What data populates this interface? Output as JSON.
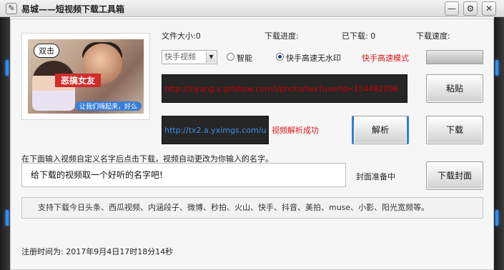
{
  "window": {
    "title": "易城——短视频下载工具箱",
    "icon": "app-icon",
    "controls": [
      "minimize-icon",
      "settings-icon",
      "close-icon"
    ]
  },
  "thumbnail": {
    "bubble_text": "双击",
    "red_caption": "恶搞女友",
    "blue_caption": "让我们嗨起来，好么"
  },
  "status": {
    "file_size_label": "文件大小:0",
    "progress_label": "下载进度:",
    "downloaded_label": "已下载: 0",
    "speed_label": "下载速度:"
  },
  "mode": {
    "select_value": "快手视频",
    "radio_smart": "智能",
    "radio_fast": "快手高速无水印",
    "selected": "fast",
    "mode_text": "快手高速模式"
  },
  "urls": {
    "source_url": "http://ziyang.s.gifshow.com/i/photo/lwx?userId=154462096",
    "parsed_url": "http://tx2.a.yximgs.com/u",
    "parse_status": "视频解析成功"
  },
  "buttons": {
    "paste": "粘贴",
    "parse": "解析",
    "download": "下载",
    "download_cover": "下载封面"
  },
  "naming": {
    "hint": "在下面输入视频自定义名字后点击下载，视频自动更改为你输入的名字。",
    "input_value": "给下载的视频取一个好听的名字吧!",
    "cover_status": "封面准备中"
  },
  "platforms_text": "支持下载今日头条、西瓜视频、内涵段子、微博、秒拍、火山、快手、抖音、美拍、muse、小影、阳光宽频等。",
  "registration": "注册时间为: 2017年9月4日17时18分14秒",
  "colors": {
    "accent_blue": "#2e8cff",
    "status_red": "#e01818",
    "url_red": "#cc0000",
    "url_blue": "#3b8ee8"
  }
}
